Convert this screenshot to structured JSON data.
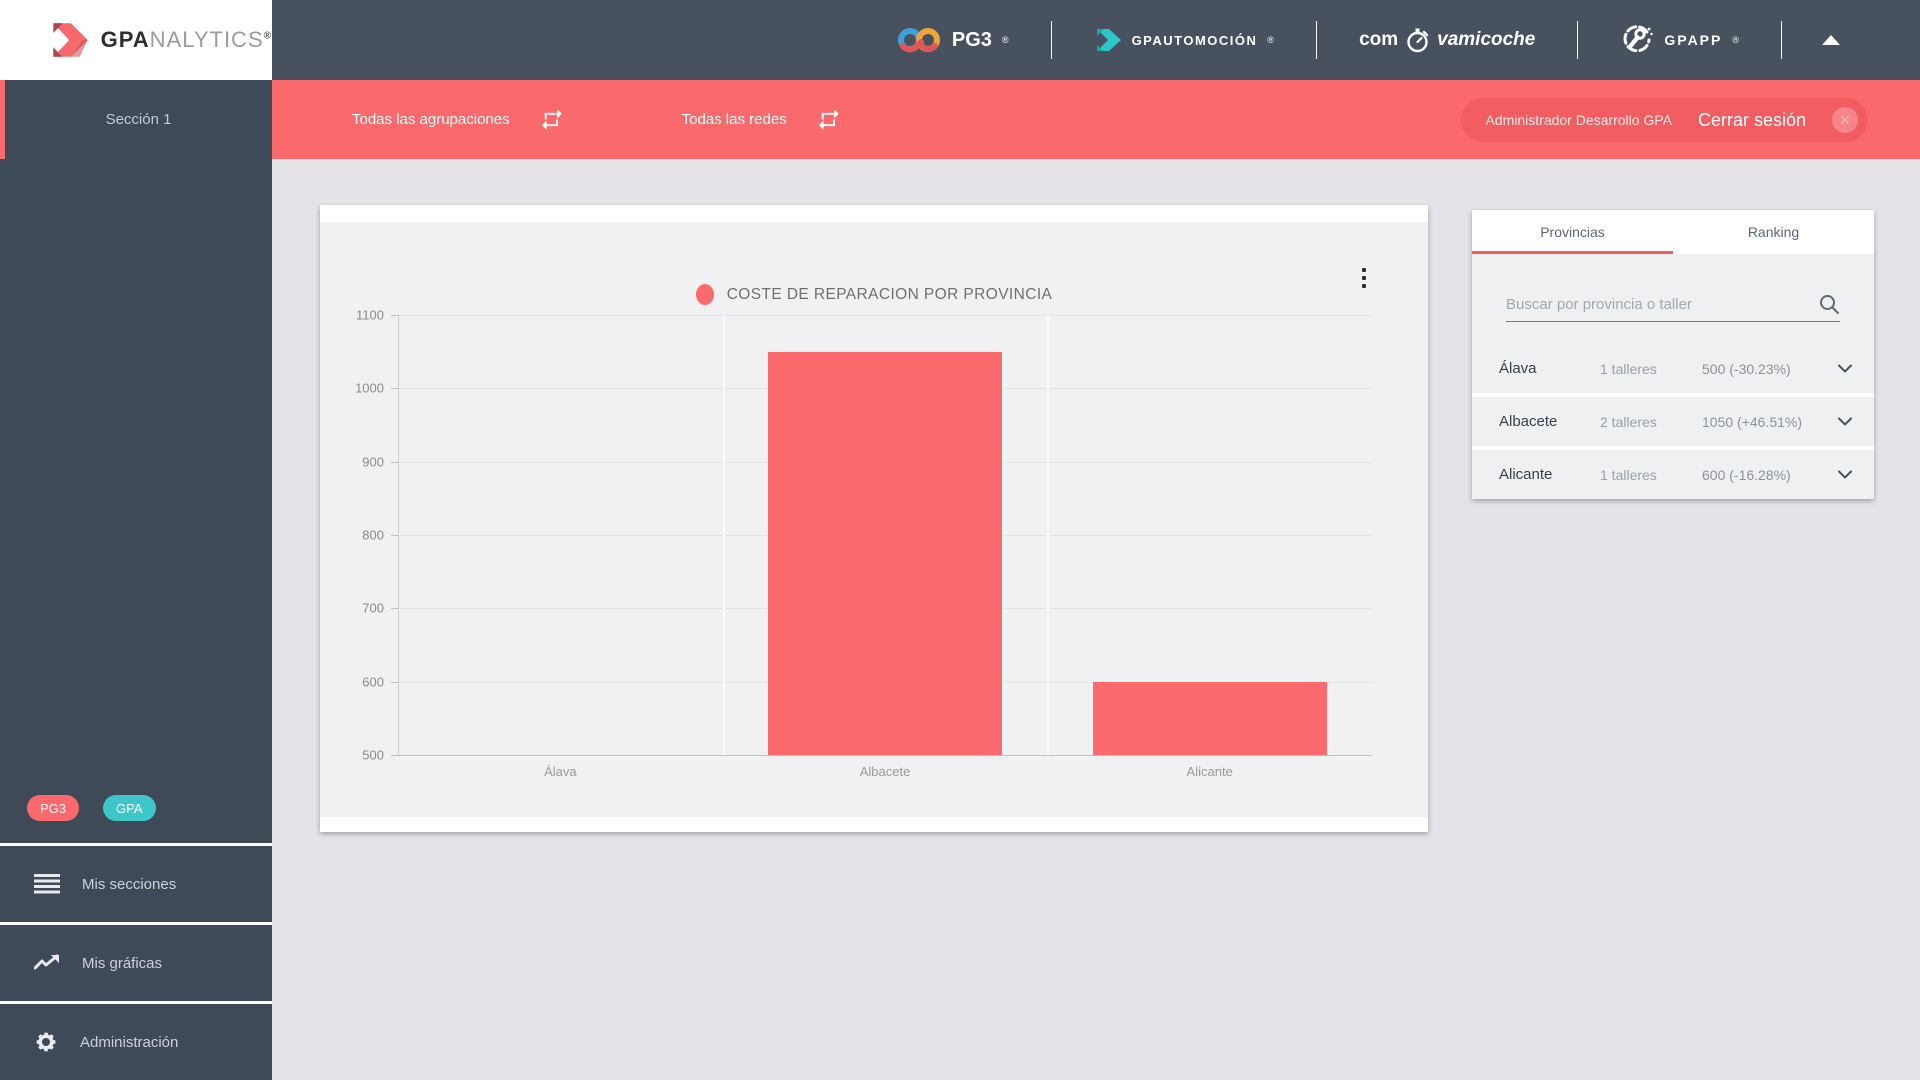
{
  "brand": {
    "bold": "GPA",
    "light": "NALYTICS",
    "reg": "®"
  },
  "header": {
    "pg3": {
      "label": "PG3",
      "reg": "®"
    },
    "automocion": {
      "label": "GPAUTOMOCIÓN",
      "reg": "®"
    },
    "micoche": {
      "pre": "com",
      "post": "vamicoche"
    },
    "gpapp": {
      "label": "GPAPP",
      "reg": "®"
    }
  },
  "sidebar": {
    "section_label": "Sección 1",
    "badges": [
      {
        "label": "PG3"
      },
      {
        "label": "GPA"
      }
    ],
    "menu": [
      {
        "label": "Mis secciones"
      },
      {
        "label": "Mis gráficas"
      },
      {
        "label": "Administración"
      }
    ]
  },
  "filter_bar": {
    "agrupaciones": "Todas las agrupaciones",
    "redes": "Todas las redes",
    "user": "Administrador Desarrollo GPA",
    "logout": "Cerrar sesión"
  },
  "chart_data": {
    "type": "bar",
    "title": "COSTE DE REPARACION POR PROVINCIA",
    "categories": [
      "Álava",
      "Albacete",
      "Alicante"
    ],
    "values": [
      500,
      1050,
      600
    ],
    "ylim": [
      500,
      1100
    ],
    "ytick_step": 100,
    "yticks": [
      500,
      600,
      700,
      800,
      900,
      1000,
      1100
    ],
    "bar_color": "#fb6b6e",
    "legend_position": "top-center",
    "grid": true
  },
  "side_panel": {
    "tabs": [
      {
        "label": "Provincias",
        "active": true
      },
      {
        "label": "Ranking",
        "active": false
      }
    ],
    "search_placeholder": "Buscar por provincia o taller",
    "rows": [
      {
        "name": "Álava",
        "talleres": "1 talleres",
        "value": "500 (-30.23%)"
      },
      {
        "name": "Albacete",
        "talleres": "2 talleres",
        "value": "1050 (+46.51%)"
      },
      {
        "name": "Alicante",
        "talleres": "1 talleres",
        "value": "600 (-16.28%)"
      }
    ]
  },
  "colors": {
    "accent_red": "#fa696c",
    "teal": "#3fc6c9",
    "header_dark": "#48525e",
    "sidebar_dark": "#3e4a57",
    "chart_bg": "#f0f1f3"
  }
}
